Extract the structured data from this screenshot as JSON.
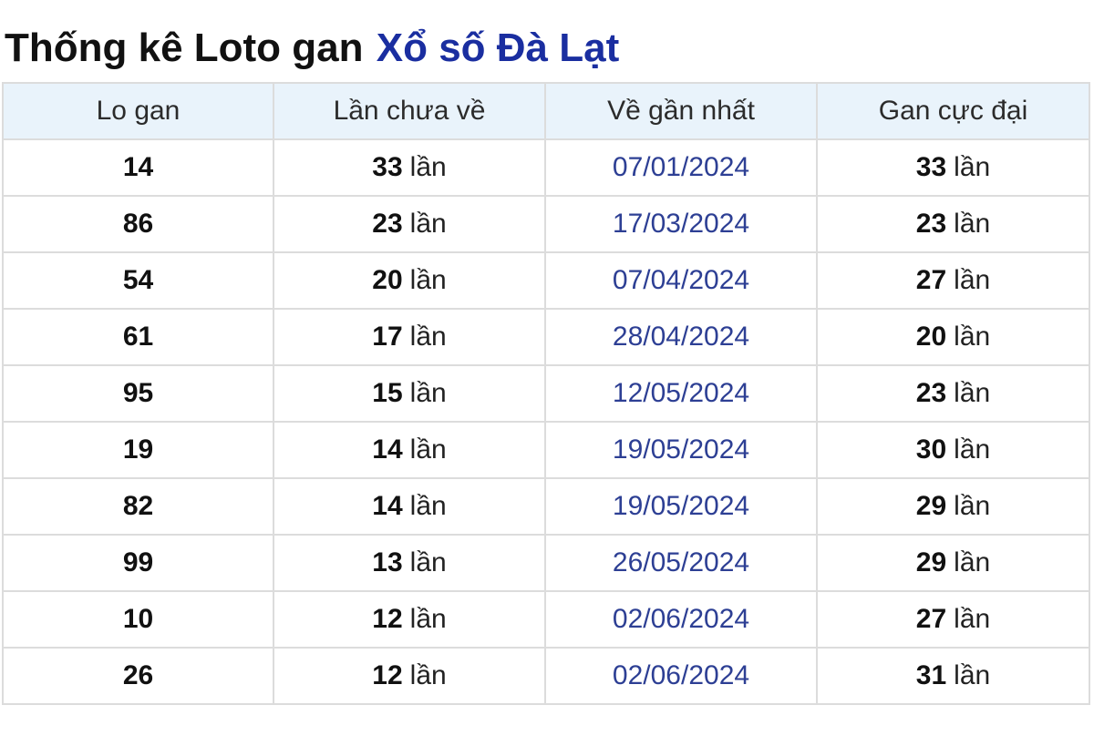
{
  "title": {
    "prefix": "Thống kê Loto gan",
    "link": "Xổ số Đà Lạt"
  },
  "table": {
    "headers": [
      "Lo gan",
      "Lần chưa về",
      "Về gần nhất",
      "Gan cực đại"
    ],
    "unit": "lần",
    "rows": [
      {
        "lo": "14",
        "chua_ve": "33",
        "gan_nhat": "07/01/2024",
        "cuc_dai": "33"
      },
      {
        "lo": "86",
        "chua_ve": "23",
        "gan_nhat": "17/03/2024",
        "cuc_dai": "23"
      },
      {
        "lo": "54",
        "chua_ve": "20",
        "gan_nhat": "07/04/2024",
        "cuc_dai": "27"
      },
      {
        "lo": "61",
        "chua_ve": "17",
        "gan_nhat": "28/04/2024",
        "cuc_dai": "20"
      },
      {
        "lo": "95",
        "chua_ve": "15",
        "gan_nhat": "12/05/2024",
        "cuc_dai": "23"
      },
      {
        "lo": "19",
        "chua_ve": "14",
        "gan_nhat": "19/05/2024",
        "cuc_dai": "30"
      },
      {
        "lo": "82",
        "chua_ve": "14",
        "gan_nhat": "19/05/2024",
        "cuc_dai": "29"
      },
      {
        "lo": "99",
        "chua_ve": "13",
        "gan_nhat": "26/05/2024",
        "cuc_dai": "29"
      },
      {
        "lo": "10",
        "chua_ve": "12",
        "gan_nhat": "02/06/2024",
        "cuc_dai": "27"
      },
      {
        "lo": "26",
        "chua_ve": "12",
        "gan_nhat": "02/06/2024",
        "cuc_dai": "31"
      }
    ]
  },
  "colors": {
    "link": "#1a2ea0",
    "header_bg": "#e9f3fb",
    "date_text": "#2d3f94",
    "border": "#dcdcdc"
  }
}
